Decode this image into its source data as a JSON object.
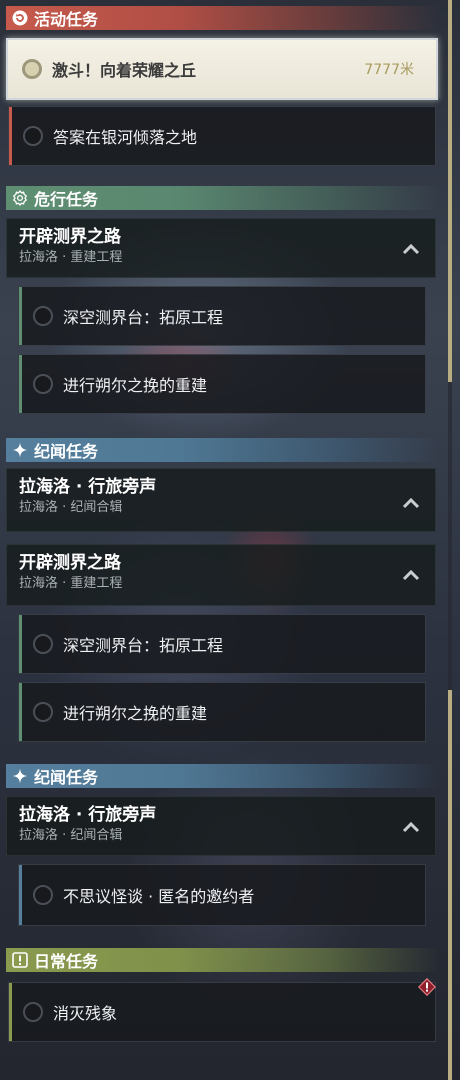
{
  "categories": {
    "active": "活动任务",
    "danger": "危行任务",
    "story1": "纪闻任务",
    "story2": "纪闻任务",
    "daily": "日常任务"
  },
  "active_tasks": [
    {
      "label": "激斗！向着荣耀之丘",
      "distance": "7777米"
    },
    {
      "label": "答案在银河倾落之地"
    }
  ],
  "danger_group": {
    "title": "开辟测界之路",
    "subtitle": "拉海洛 · 重建工程"
  },
  "danger_tasks": [
    {
      "label": "深空测界台：拓原工程"
    },
    {
      "label": "进行朔尔之挽的重建"
    }
  ],
  "story_group1": {
    "title": "拉海洛 · 行旅旁声",
    "subtitle": "拉海洛 · 纪闻合辑"
  },
  "repeat_group": {
    "title": "开辟测界之路",
    "subtitle": "拉海洛 · 重建工程"
  },
  "repeat_tasks": [
    {
      "label": "深空测界台：拓原工程"
    },
    {
      "label": "进行朔尔之挽的重建"
    }
  ],
  "story_group2": {
    "title": "拉海洛 · 行旅旁声",
    "subtitle": "拉海洛 · 纪闻合辑"
  },
  "story_tasks": [
    {
      "label": "不思议怪谈 · 匿名的邀约者"
    }
  ],
  "daily_tasks": [
    {
      "label": "消灭残象"
    }
  ],
  "colors": {
    "active": "#c65a4c",
    "danger": "#5f8f72",
    "story": "#557f9d",
    "daily": "#8a9a4f",
    "distance": "#a89a5e"
  },
  "icons": {
    "active": "refresh-icon",
    "danger": "gear-icon",
    "story": "sparkle-icon",
    "daily": "exclamation-icon",
    "warning": "warning-diamond-icon",
    "expand": "chevron-up-icon"
  }
}
